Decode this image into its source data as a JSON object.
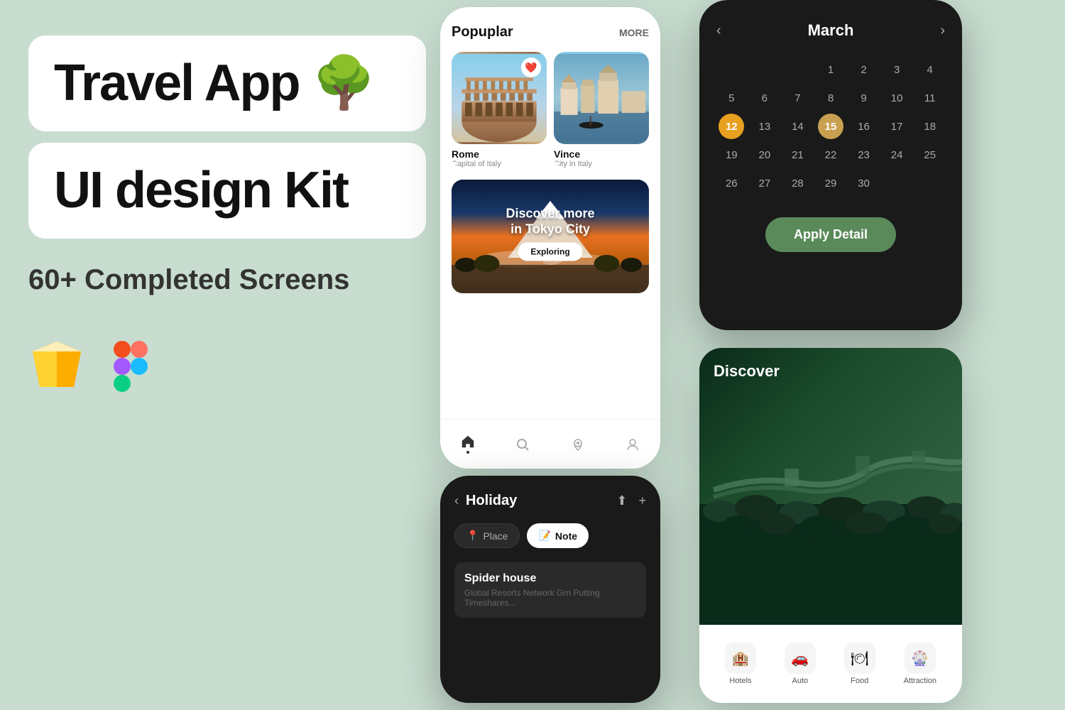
{
  "background_color": "#c8ddd0",
  "left": {
    "title_line1": "Travel App 🌳",
    "subtitle_line1": "UI design Kit",
    "completed_text": "60+ Completed Screens",
    "sketch_label": "Sketch",
    "figma_label": "Figma"
  },
  "phone1": {
    "popular_label": "Popuplar",
    "more_label": "MORE",
    "city1_name": "Rome",
    "city1_sub": "Capital of Italy",
    "city2_name": "Vince",
    "city2_sub": "City in Italy",
    "tokyo_title": "Discover more in Tokyo City",
    "tokyo_btn": "Exploring",
    "nav_items": [
      "home",
      "search",
      "map",
      "profile"
    ]
  },
  "phone2": {
    "month": "March",
    "prev_icon": "‹",
    "next_icon": "›",
    "apply_btn": "Apply Detail",
    "days": [
      {
        "num": "1"
      },
      {
        "num": "2"
      },
      {
        "num": "3"
      },
      {
        "num": "4"
      },
      {
        "num": "5"
      },
      {
        "num": "6"
      },
      {
        "num": "7"
      },
      {
        "num": "8"
      },
      {
        "num": "9"
      },
      {
        "num": "10"
      },
      {
        "num": "11"
      },
      {
        "num": "12",
        "type": "today"
      },
      {
        "num": "13"
      },
      {
        "num": "14"
      },
      {
        "num": "15",
        "type": "selected"
      },
      {
        "num": "16"
      },
      {
        "num": "17"
      },
      {
        "num": "18"
      },
      {
        "num": "19"
      },
      {
        "num": "20"
      },
      {
        "num": "21"
      },
      {
        "num": "22"
      },
      {
        "num": "23"
      },
      {
        "num": "24"
      },
      {
        "num": "25"
      },
      {
        "num": "26"
      },
      {
        "num": "27"
      },
      {
        "num": "28"
      },
      {
        "num": "29"
      },
      {
        "num": "30"
      }
    ]
  },
  "phone3": {
    "back_icon": "‹",
    "title": "Holiday",
    "share_icon": "⬆",
    "add_icon": "+",
    "tab_place": "Place",
    "tab_note": "Note",
    "place_icon": "📍",
    "note_icon": "📝",
    "item_name": "Spider house",
    "item_sub": "Global Resorts Network Grn Putting Timeshares..."
  },
  "discover": {
    "title": "Discover",
    "categories": [
      {
        "label": "Hotels",
        "icon": "🏨"
      },
      {
        "label": "Auto",
        "icon": "🚗"
      },
      {
        "label": "Food",
        "icon": "🍽"
      },
      {
        "label": "Attraction",
        "icon": "🎡"
      }
    ]
  }
}
